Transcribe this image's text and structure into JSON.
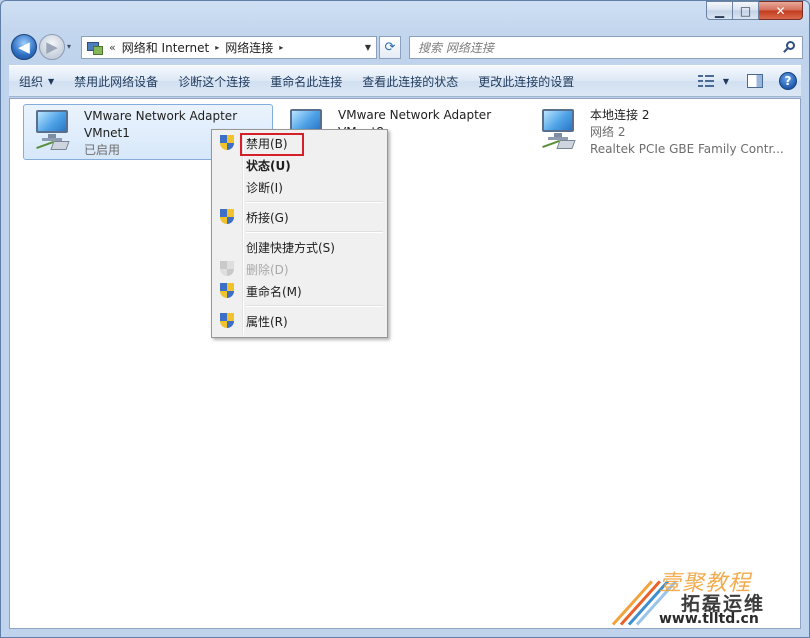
{
  "window": {
    "minimize_glyph": "▁",
    "maximize_glyph": "□",
    "close_glyph": "✕"
  },
  "nav": {
    "back_glyph": "◀",
    "forward_glyph": "▶",
    "history_glyph": "▾",
    "address": {
      "overflow": "«",
      "crumbs": [
        "网络和 Internet",
        "网络连接"
      ],
      "arrow": "▸",
      "dropdown_glyph": "▼"
    },
    "refresh_glyph": "⟳",
    "search_placeholder": "搜索 网络连接"
  },
  "toolbar": {
    "organize": "组织",
    "dropdown_glyph": "▼",
    "disable_device": "禁用此网络设备",
    "diagnose": "诊断这个连接",
    "rename": "重命名此连接",
    "view_status": "查看此连接的状态",
    "change_settings": "更改此连接的设置",
    "help": "?"
  },
  "adapters": [
    {
      "name": "VMware Network Adapter",
      "line2": "VMnet1",
      "line3": "已启用",
      "selected": true
    },
    {
      "name": "VMware Network Adapter",
      "line2": "VMnet8",
      "line3": ""
    },
    {
      "name": "本地连接 2",
      "line2": "网络  2",
      "line3": "Realtek PCIe GBE Family Contr..."
    }
  ],
  "context_menu": {
    "items": [
      {
        "label": "禁用(B)",
        "shield": true,
        "highlighted": true
      },
      {
        "label": "状态(U)",
        "bold": true
      },
      {
        "label": "诊断(I)"
      },
      {
        "label": "桥接(G)",
        "shield": true
      },
      {
        "label": "创建快捷方式(S)"
      },
      {
        "label": "删除(D)",
        "shield": true,
        "disabled": true
      },
      {
        "label": "重命名(M)",
        "shield": true
      },
      {
        "label": "属性(R)",
        "shield": true
      }
    ],
    "highlight_color": "#d5202a"
  },
  "watermark": {
    "line1": "壹聚教程",
    "line2": "拓磊运维",
    "line3": "www.tlltd.cn",
    "stripe_colors": [
      "#f2a33c",
      "#e9612b",
      "#3f8fd0",
      "#9bc5e8"
    ]
  }
}
